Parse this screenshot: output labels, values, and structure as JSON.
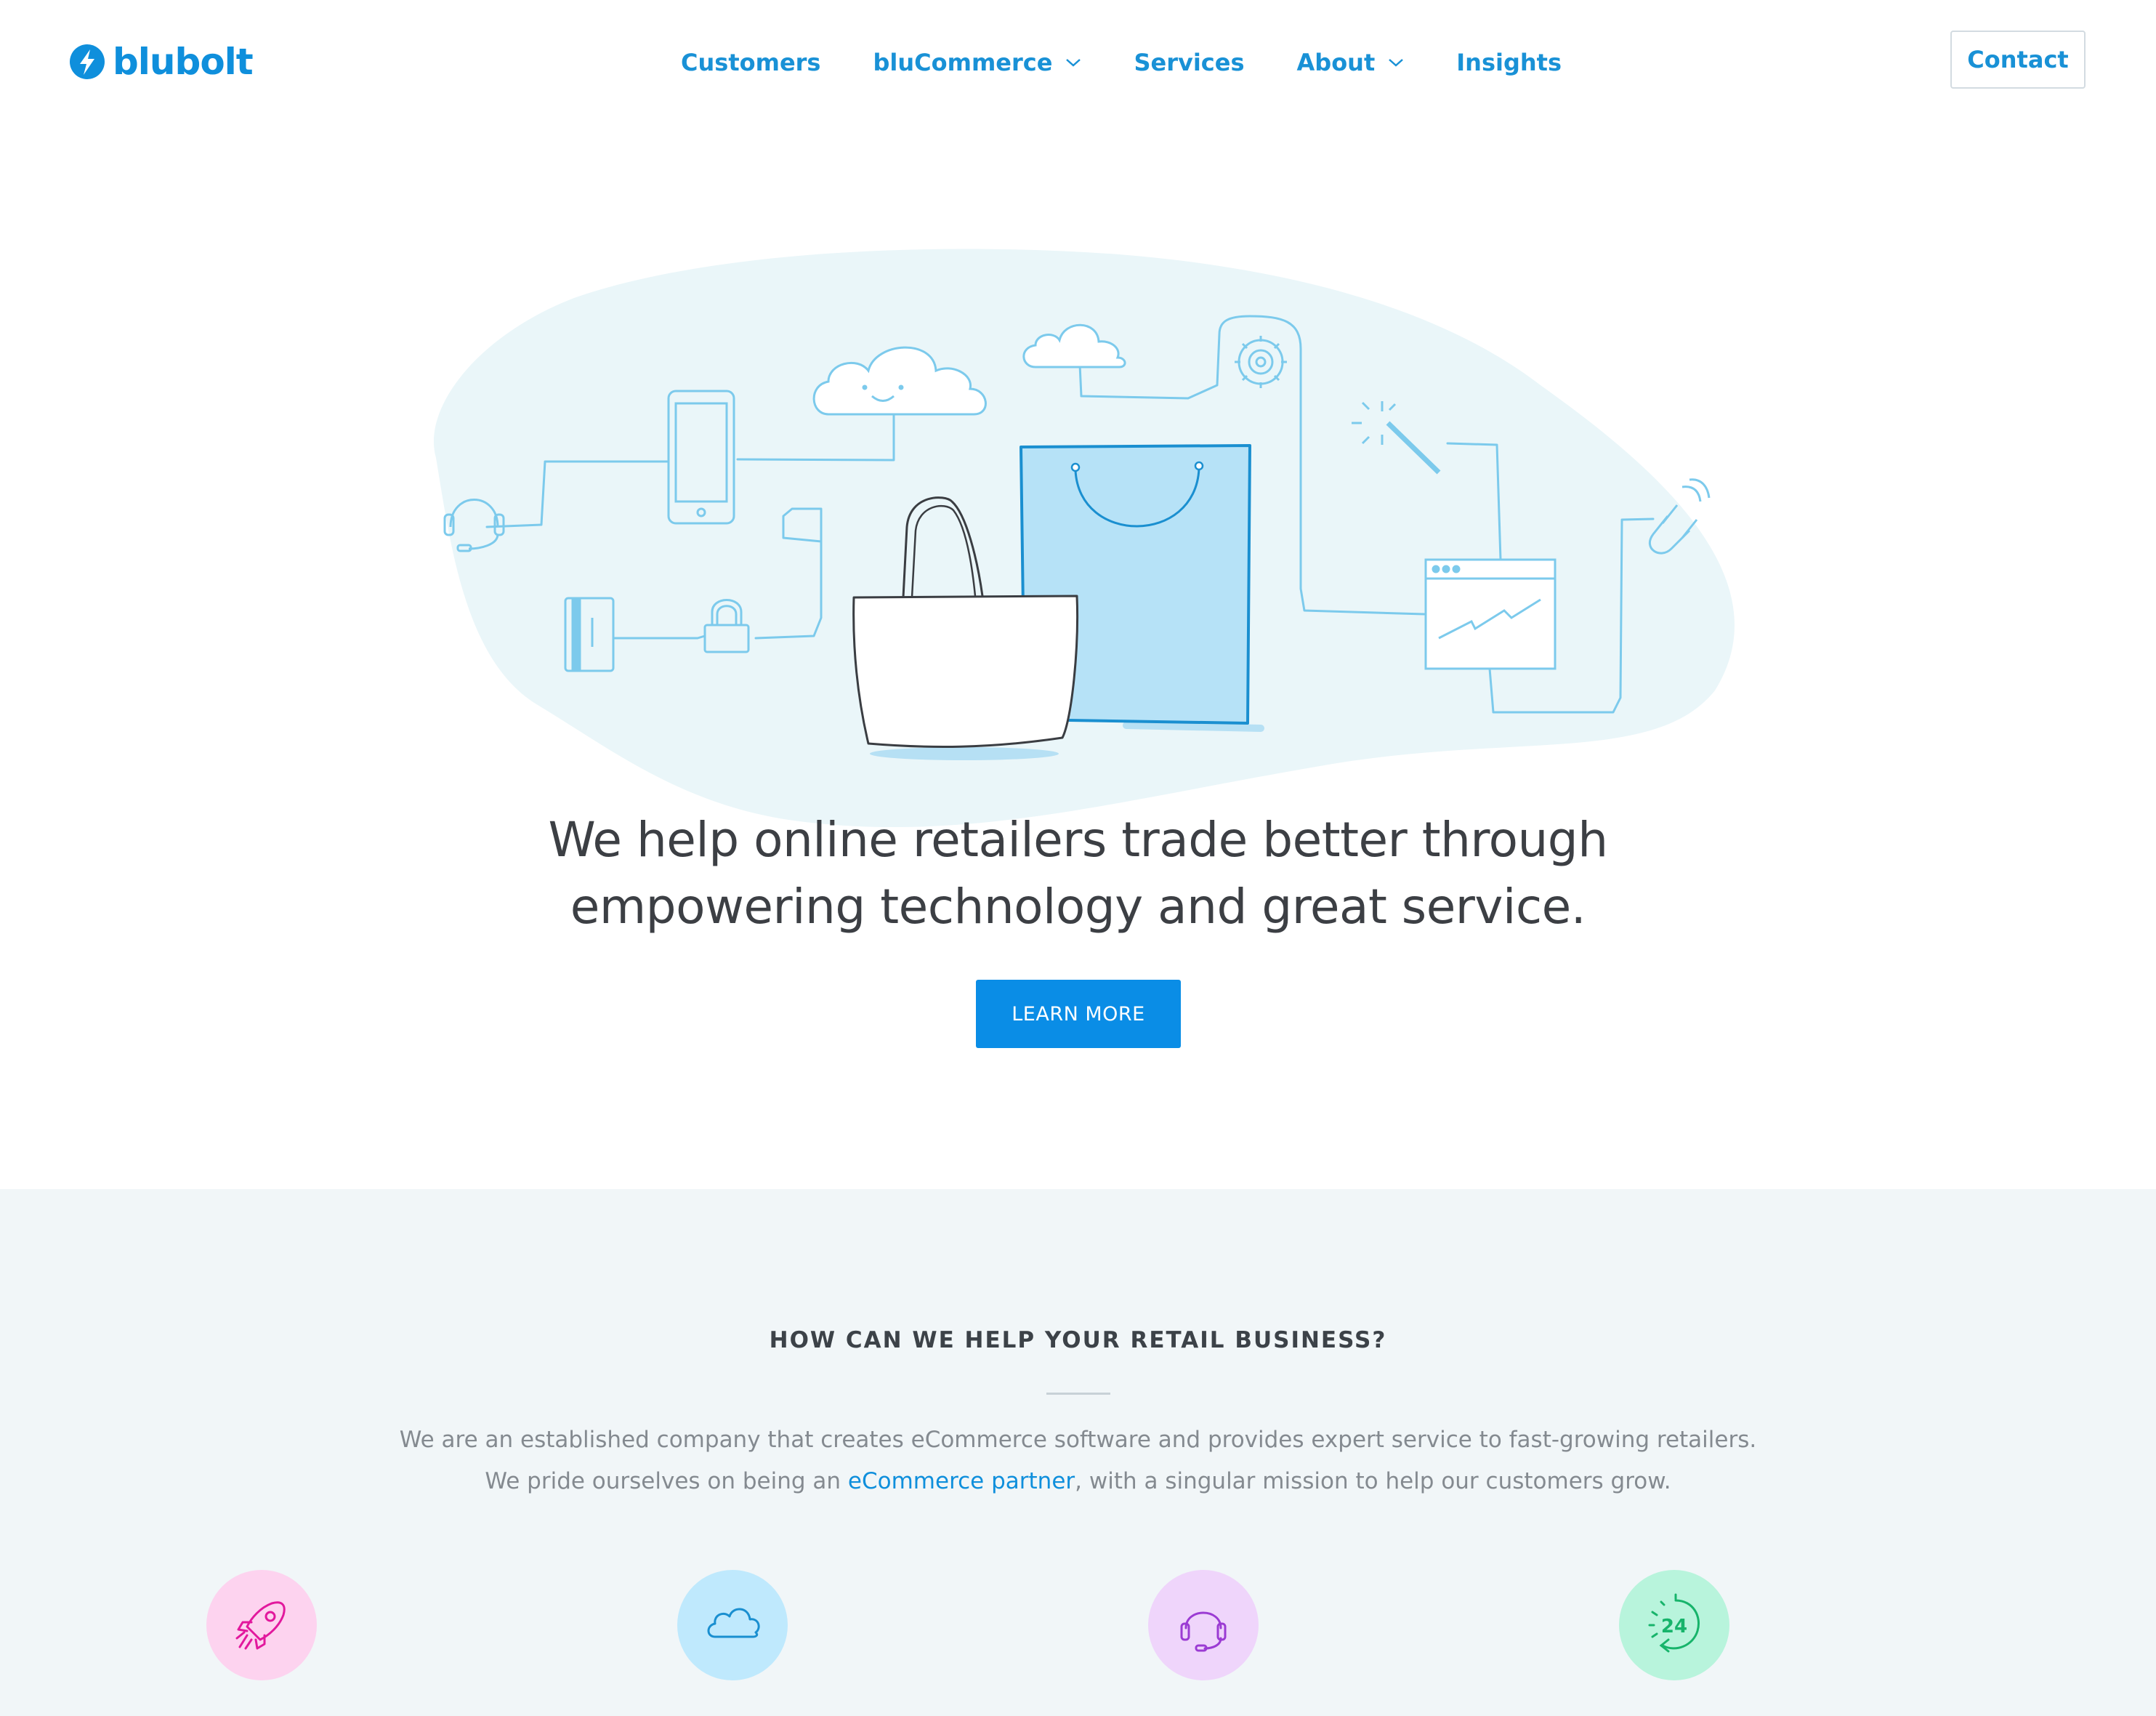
{
  "brand": {
    "name": "blubolt",
    "color": "#0f8fdc"
  },
  "nav": {
    "items": [
      {
        "label": "Customers",
        "has_dropdown": false
      },
      {
        "label": "bluCommerce",
        "has_dropdown": true
      },
      {
        "label": "Services",
        "has_dropdown": false
      },
      {
        "label": "About",
        "has_dropdown": true
      },
      {
        "label": "Insights",
        "has_dropdown": false
      }
    ],
    "contact_label": "Contact"
  },
  "hero": {
    "headline_line1": "We help online retailers trade better through",
    "headline_line2": "empowering technology and great service.",
    "cta_label": "LEARN MORE",
    "illustration_icons": [
      "headset-icon",
      "phone-icon",
      "cloud-icon",
      "gear-icon",
      "magic-wand-icon",
      "magnet-icon",
      "credit-card-icon",
      "padlock-icon",
      "browser-chart-icon",
      "tote-bag-icon",
      "shopping-bag-icon"
    ]
  },
  "help": {
    "title": "HOW CAN WE HELP YOUR RETAIL BUSINESS?",
    "line1": "We are an established company that creates eCommerce software and provides expert service to fast-growing retailers.",
    "line2_before": "We pride ourselves on being an ",
    "line2_link": "eCommerce partner",
    "line2_after": ", with a singular mission to help our customers grow.",
    "features": [
      {
        "icon": "rocket-icon",
        "bg": "#fdd3ef",
        "color": "#e2189d"
      },
      {
        "icon": "cloud-icon",
        "bg": "#bfe9fd",
        "color": "#1a8fd0"
      },
      {
        "icon": "headset-icon",
        "bg": "#efd5fb",
        "color": "#9b3bd3"
      },
      {
        "icon": "support-24-icon",
        "bg": "#b8f4dc",
        "color": "#17b46b"
      }
    ]
  },
  "colors": {
    "accent": "#0a8de6",
    "illustration_line": "#7ccaec",
    "illustration_blob": "#eaf6f9",
    "section_bg": "#f1f6f8"
  }
}
